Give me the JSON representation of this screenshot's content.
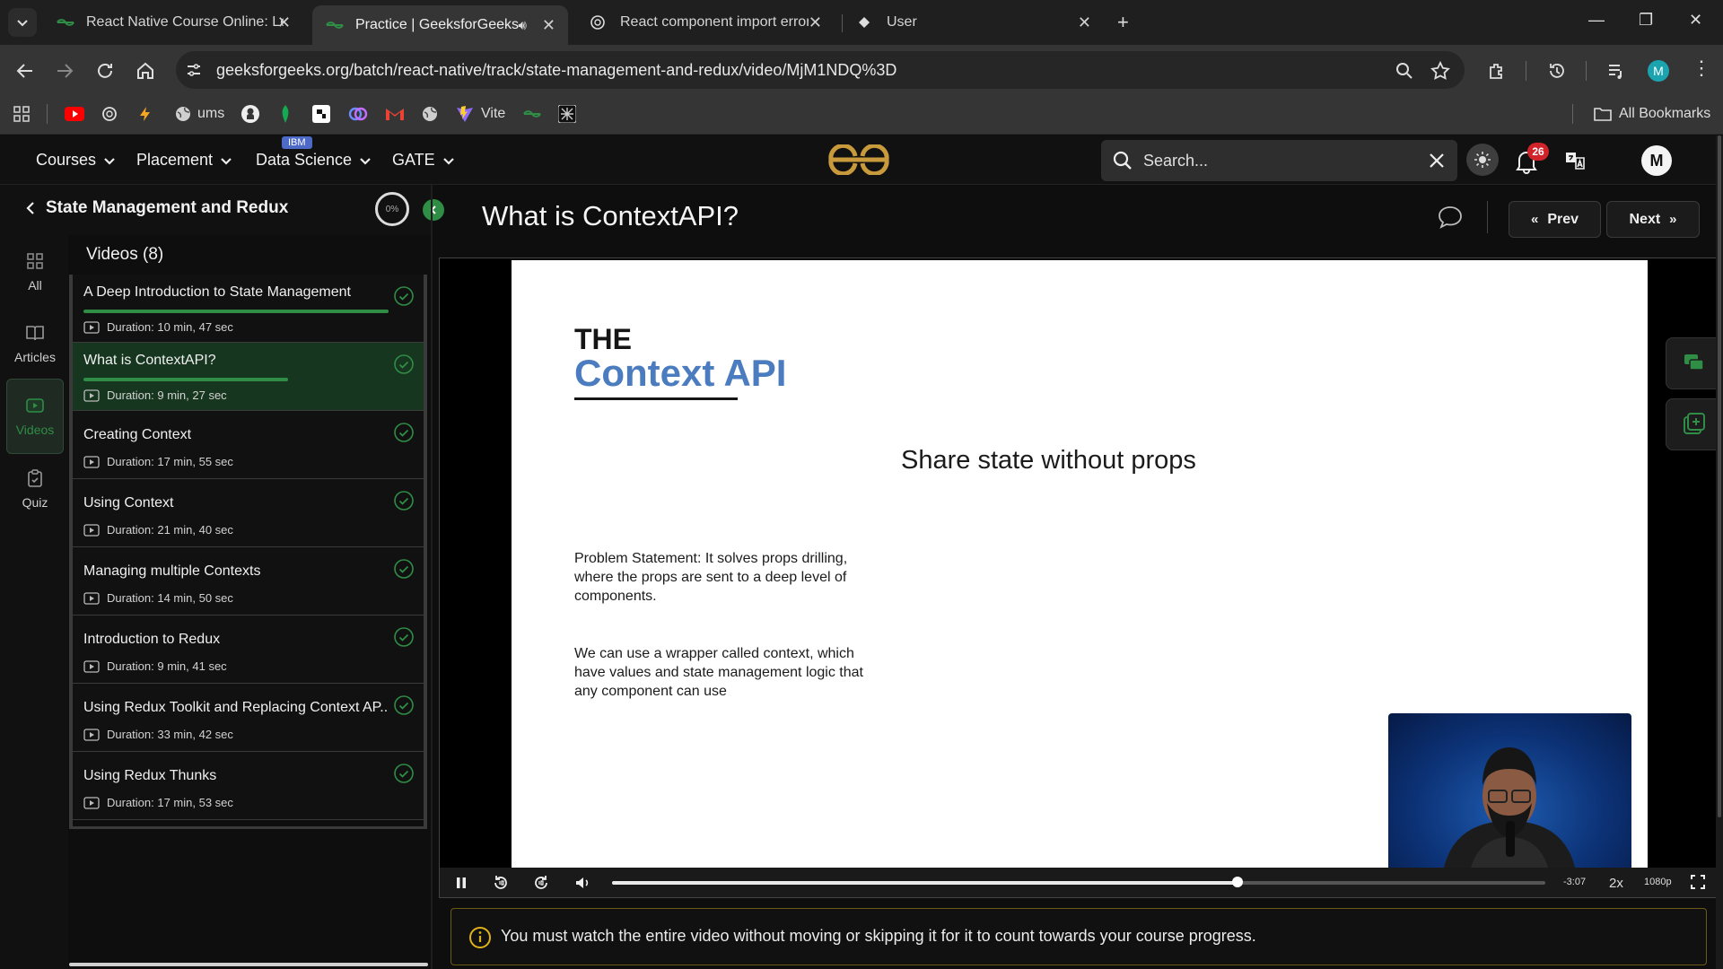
{
  "browser": {
    "tabs": [
      {
        "title": "React Native Course Online: Lea",
        "active": false
      },
      {
        "title": "Practice | GeeksforGeeks | A",
        "active": true
      },
      {
        "title": "React component import error",
        "active": false
      },
      {
        "title": "User",
        "active": false
      }
    ],
    "url": "geeksforgeeks.org/batch/react-native/track/state-management-and-redux/video/MjM1NDQ%3D",
    "bookmarks": [
      {
        "label": "ums"
      },
      {
        "label": "Vite"
      }
    ],
    "all_bookmarks_label": "All Bookmarks",
    "profile_initial": "M"
  },
  "site": {
    "menu": [
      {
        "label": "Courses"
      },
      {
        "label": "Placement"
      },
      {
        "label": "Data Science"
      },
      {
        "label": "GATE"
      }
    ],
    "ibm_badge": "IBM",
    "search_placeholder": "Search...",
    "notification_count": "26",
    "avatar_initial": "M"
  },
  "sidebar": {
    "course_title": "State Management and Redux",
    "progress_label": "0%",
    "rail": [
      {
        "label": "All",
        "icon": "grid-icon",
        "active": false
      },
      {
        "label": "Articles",
        "icon": "book-icon",
        "active": false
      },
      {
        "label": "Videos",
        "icon": "video-icon",
        "active": true
      },
      {
        "label": "Quiz",
        "icon": "clipboard-icon",
        "active": false
      }
    ],
    "videos_heading": "Videos (8)",
    "videos": [
      {
        "title": "A Deep Introduction to State Management",
        "duration": "Duration: 10 min, 47 sec",
        "watched_fraction": 1.0,
        "current": false,
        "completed": true
      },
      {
        "title": "What is ContextAPI?",
        "duration": "Duration: 9 min, 27 sec",
        "watched_fraction": 0.67,
        "current": true,
        "completed": true
      },
      {
        "title": "Creating Context",
        "duration": "Duration: 17 min, 55 sec",
        "watched_fraction": 0,
        "current": false,
        "completed": true
      },
      {
        "title": "Using Context",
        "duration": "Duration: 21 min, 40 sec",
        "watched_fraction": 0,
        "current": false,
        "completed": true
      },
      {
        "title": "Managing multiple Contexts",
        "duration": "Duration: 14 min, 50 sec",
        "watched_fraction": 0,
        "current": false,
        "completed": true
      },
      {
        "title": "Introduction to Redux",
        "duration": "Duration: 9 min, 41 sec",
        "watched_fraction": 0,
        "current": false,
        "completed": true
      },
      {
        "title": "Using Redux Toolkit and Replacing Context AP...",
        "duration": "Duration: 33 min, 42 sec",
        "watched_fraction": 0,
        "current": false,
        "completed": true
      },
      {
        "title": "Using Redux Thunks",
        "duration": "Duration: 17 min, 53 sec",
        "watched_fraction": 0,
        "current": false,
        "completed": true
      }
    ]
  },
  "main": {
    "lesson_title": "What is ContextAPI?",
    "prev_label": "Prev",
    "next_label": "Next",
    "slide": {
      "heading_small": "THE",
      "heading_large": "Context API",
      "subtitle": "Share state without props",
      "paragraph1": "Problem Statement: It solves props drilling, where the props are sent to a deep level of components.",
      "paragraph2": "We can use a wrapper called context, which have values and state management logic that any component can use"
    },
    "player": {
      "progress_fraction": 0.67,
      "time_remaining": "-3:07",
      "speed": "2x",
      "quality": "1080p"
    },
    "notice": "You must watch the entire video without moving or skipping it for it to count towards your course progress."
  },
  "colors": {
    "accent_green": "#2f8d46",
    "context_blue": "#4a7cbf",
    "badge_red": "#d0242a",
    "ibm_blue": "#4d6ac7"
  }
}
